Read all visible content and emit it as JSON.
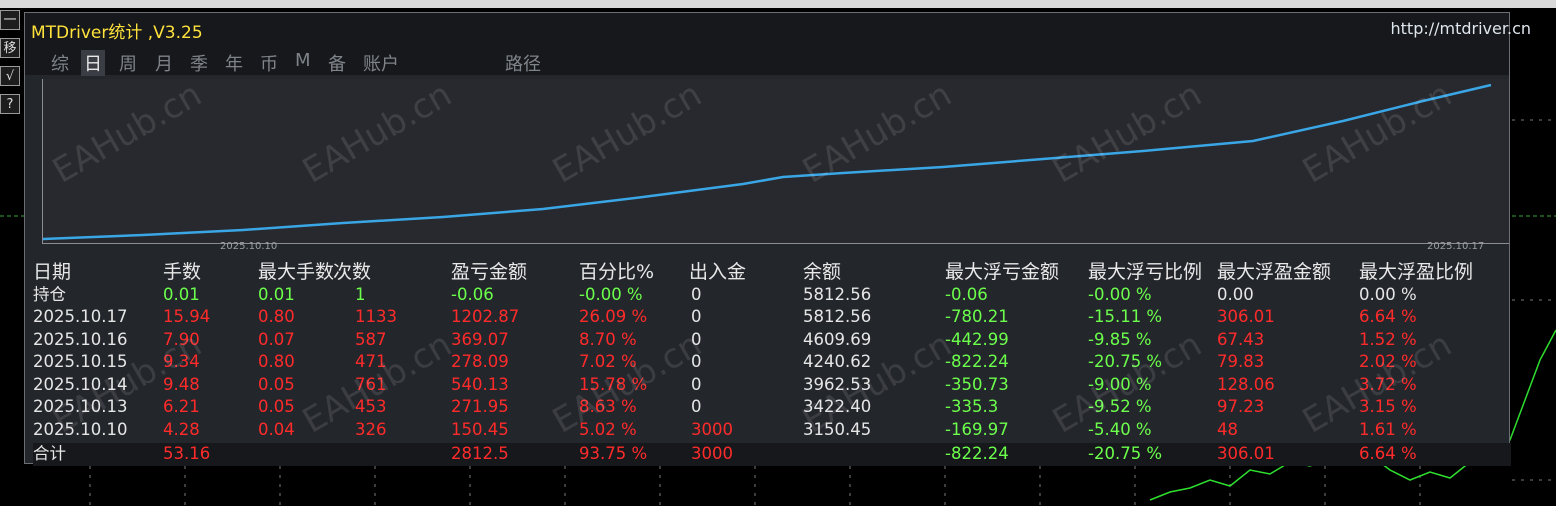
{
  "app": {
    "title": "MTDriver统计 ,V3.25",
    "url": "http://mtdriver.cn"
  },
  "toolbar": {
    "buttons": [
      {
        "label": "一",
        "icon": "minimize-icon"
      },
      {
        "label": "移",
        "icon": "move-icon"
      },
      {
        "label": "√",
        "icon": "check-icon"
      },
      {
        "label": "?",
        "icon": "help-icon"
      }
    ]
  },
  "tabs": {
    "items": [
      {
        "label": "综"
      },
      {
        "label": "日"
      },
      {
        "label": "周"
      },
      {
        "label": "月"
      },
      {
        "label": "季"
      },
      {
        "label": "年"
      },
      {
        "label": "币"
      },
      {
        "label": "M"
      },
      {
        "label": "备"
      },
      {
        "label": "账户"
      },
      {
        "label": "路径"
      }
    ],
    "active": "日"
  },
  "equity_chart": {
    "x_start_label": "2025.10.10",
    "x_end_label": "2025.10.17",
    "line_color": "#3aa6e6"
  },
  "table": {
    "headers": [
      "日期",
      "手数",
      "最大手数",
      "次数",
      "盈亏金额",
      "百分比%",
      "出入金",
      "余额",
      "最大浮亏金额",
      "最大浮亏比例",
      "最大浮盈金额",
      "最大浮盈比例"
    ],
    "position_row": [
      "持仓",
      "0.01",
      "0.01",
      "1",
      "-0.06",
      "-0.00 %",
      "0",
      "5812.56",
      "-0.06",
      "-0.00 %",
      "0.00",
      "0.00 %"
    ],
    "rows": [
      [
        "2025.10.17",
        "15.94",
        "0.80",
        "1133",
        "1202.87",
        "26.09 %",
        "0",
        "5812.56",
        "-780.21",
        "-15.11 %",
        "306.01",
        "6.64 %"
      ],
      [
        "2025.10.16",
        "7.90",
        "0.07",
        "587",
        "369.07",
        "8.70 %",
        "0",
        "4609.69",
        "-442.99",
        "-9.85 %",
        "67.43",
        "1.52 %"
      ],
      [
        "2025.10.15",
        "9.34",
        "0.80",
        "471",
        "278.09",
        "7.02 %",
        "0",
        "4240.62",
        "-822.24",
        "-20.75 %",
        "79.83",
        "2.02 %"
      ],
      [
        "2025.10.14",
        "9.48",
        "0.05",
        "761",
        "540.13",
        "15.78 %",
        "0",
        "3962.53",
        "-350.73",
        "-9.00 %",
        "128.06",
        "3.72 %"
      ],
      [
        "2025.10.13",
        "6.21",
        "0.05",
        "453",
        "271.95",
        "8.63 %",
        "0",
        "3422.40",
        "-335.3",
        "-9.52 %",
        "97.23",
        "3.15 %"
      ],
      [
        "2025.10.10",
        "4.28",
        "0.04",
        "326",
        "150.45",
        "5.02 %",
        "3000",
        "3150.45",
        "-169.97",
        "-5.40 %",
        "48",
        "1.61 %"
      ]
    ],
    "total_row": [
      "合计",
      "53.16",
      "",
      "",
      "2812.5",
      "93.75 %",
      "3000",
      "",
      "-822.24",
      "-20.75 %",
      "306.01",
      "6.64 %"
    ]
  },
  "watermark": "EAHub.cn",
  "colors": {
    "title": "#ffe23b",
    "profit": "#ff2b2b",
    "loss": "#6cff4c",
    "neutral": "#e6e6e6"
  }
}
